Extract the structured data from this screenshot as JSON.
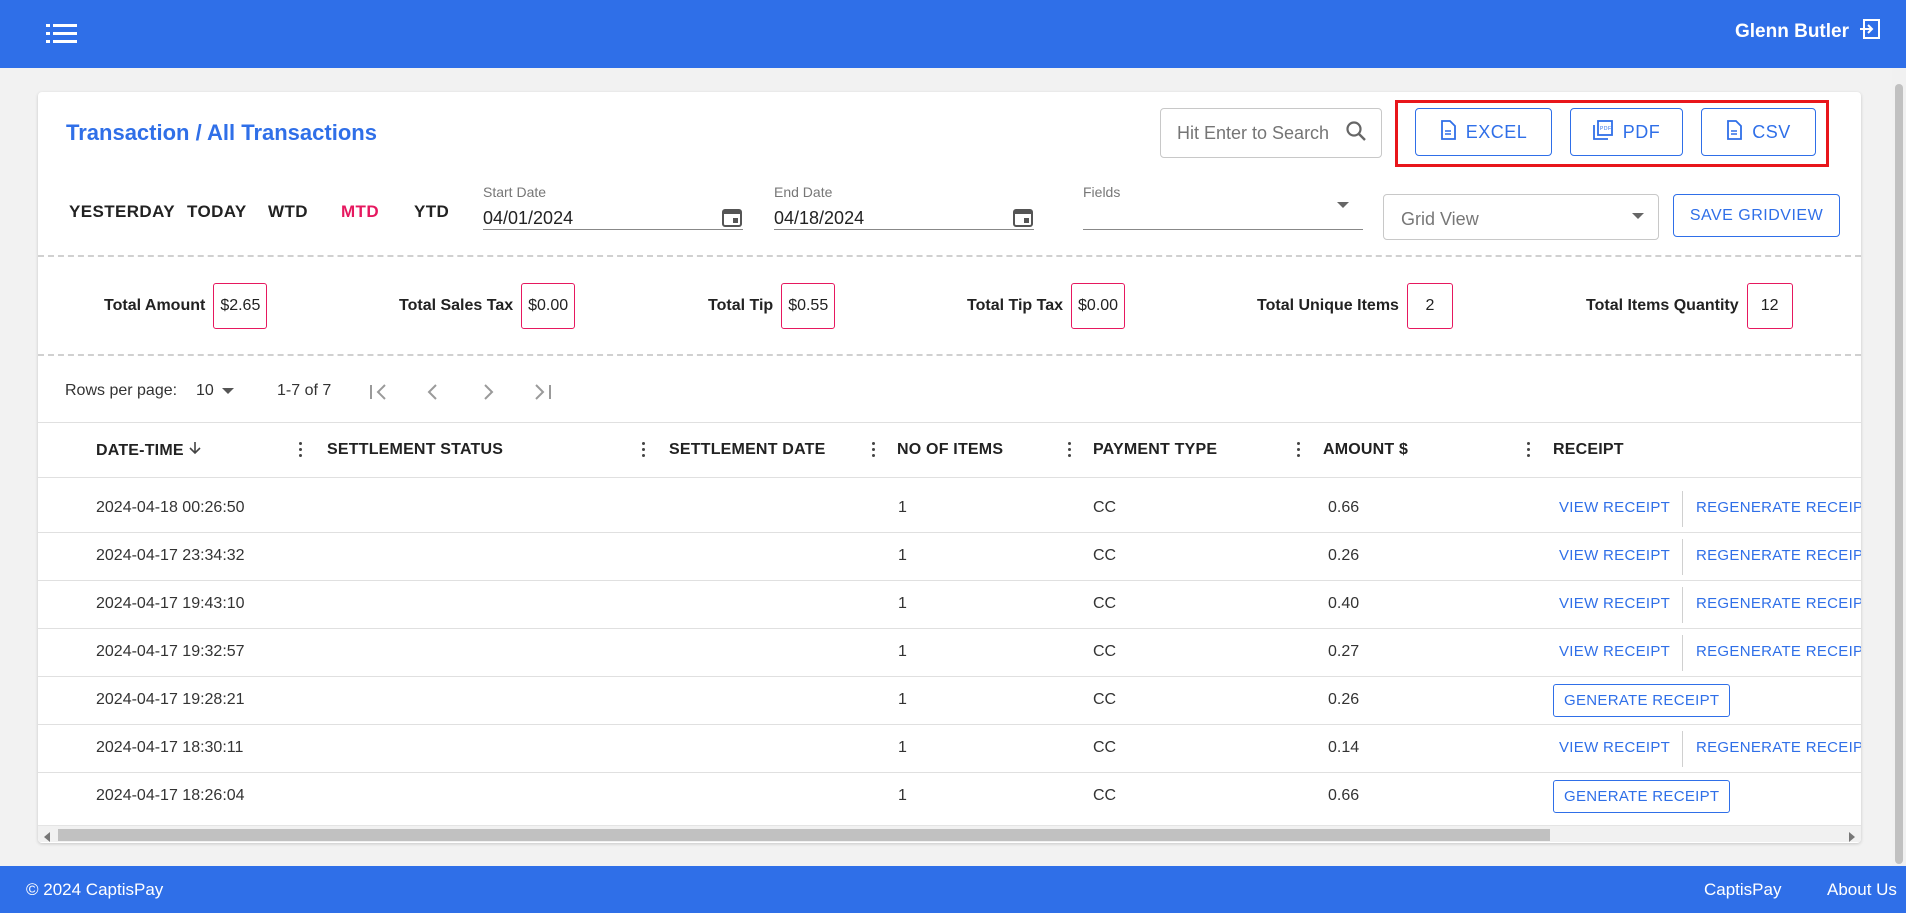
{
  "header": {
    "user_name": "Glenn Butler"
  },
  "page": {
    "title": "Transaction / All Transactions"
  },
  "search": {
    "placeholder": "Hit Enter to Search"
  },
  "export": {
    "excel": "EXCEL",
    "pdf": "PDF",
    "csv": "CSV"
  },
  "ranges": [
    "YESTERDAY",
    "TODAY",
    "WTD",
    "MTD",
    "YTD"
  ],
  "active_range": "MTD",
  "filters": {
    "start_label": "Start Date",
    "start_value": "04/01/2024",
    "end_label": "End Date",
    "end_value": "04/18/2024",
    "fields_label": "Fields",
    "grid_view_placeholder": "Grid View",
    "save_gridview": "SAVE GRIDVIEW"
  },
  "totals": [
    {
      "label": "Total Amount",
      "value": "$2.65"
    },
    {
      "label": "Total Sales Tax",
      "value": "$0.00"
    },
    {
      "label": "Total Tip",
      "value": "$0.55"
    },
    {
      "label": "Total Tip Tax",
      "value": "$0.00"
    },
    {
      "label": "Total Unique Items",
      "value": "2"
    },
    {
      "label": "Total Items Quantity",
      "value": "12"
    }
  ],
  "pagination": {
    "rows_per_page_label": "Rows per page:",
    "rows_per_page": "10",
    "range_text": "1-7 of 7"
  },
  "table": {
    "columns": [
      "DATE-TIME",
      "SETTLEMENT STATUS",
      "SETTLEMENT DATE",
      "NO OF ITEMS",
      "PAYMENT TYPE",
      "AMOUNT $",
      "RECEIPT"
    ],
    "view_label": "VIEW RECEIPT",
    "regen_label": "REGENERATE RECEIPT",
    "gen_label": "GENERATE RECEIPT",
    "rows": [
      {
        "datetime": "2024-04-18 00:26:50",
        "status": "",
        "sdate": "",
        "items": "1",
        "ptype": "CC",
        "amount": "0.66",
        "receipt": "view"
      },
      {
        "datetime": "2024-04-17 23:34:32",
        "status": "",
        "sdate": "",
        "items": "1",
        "ptype": "CC",
        "amount": "0.26",
        "receipt": "view"
      },
      {
        "datetime": "2024-04-17 19:43:10",
        "status": "",
        "sdate": "",
        "items": "1",
        "ptype": "CC",
        "amount": "0.40",
        "receipt": "view"
      },
      {
        "datetime": "2024-04-17 19:32:57",
        "status": "",
        "sdate": "",
        "items": "1",
        "ptype": "CC",
        "amount": "0.27",
        "receipt": "view"
      },
      {
        "datetime": "2024-04-17 19:28:21",
        "status": "",
        "sdate": "",
        "items": "1",
        "ptype": "CC",
        "amount": "0.26",
        "receipt": "generate"
      },
      {
        "datetime": "2024-04-17 18:30:11",
        "status": "",
        "sdate": "",
        "items": "1",
        "ptype": "CC",
        "amount": "0.14",
        "receipt": "view"
      },
      {
        "datetime": "2024-04-17 18:26:04",
        "status": "",
        "sdate": "",
        "items": "1",
        "ptype": "CC",
        "amount": "0.66",
        "receipt": "generate"
      }
    ]
  },
  "footer": {
    "copyright": "© 2024 CaptisPay",
    "link1": "CaptisPay",
    "link2": "About Us"
  },
  "colors": {
    "primary": "#2f6fe8",
    "accent": "#e6185f",
    "highlight": "#e8161b"
  }
}
